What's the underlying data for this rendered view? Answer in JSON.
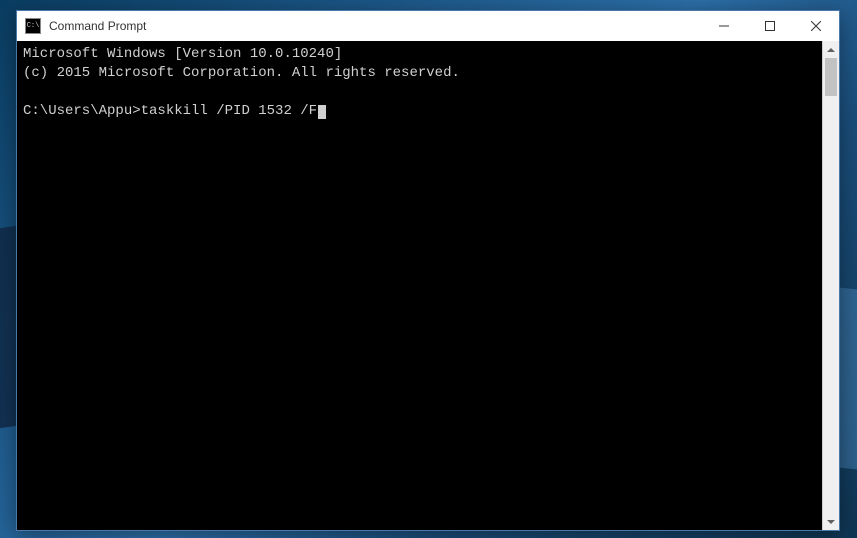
{
  "window": {
    "title": "Command Prompt",
    "icon_glyph": "C:\\"
  },
  "terminal": {
    "line1": "Microsoft Windows [Version 10.0.10240]",
    "line2": "(c) 2015 Microsoft Corporation. All rights reserved.",
    "prompt": "C:\\Users\\Appu>",
    "command": "taskkill /PID 1532 /F"
  }
}
